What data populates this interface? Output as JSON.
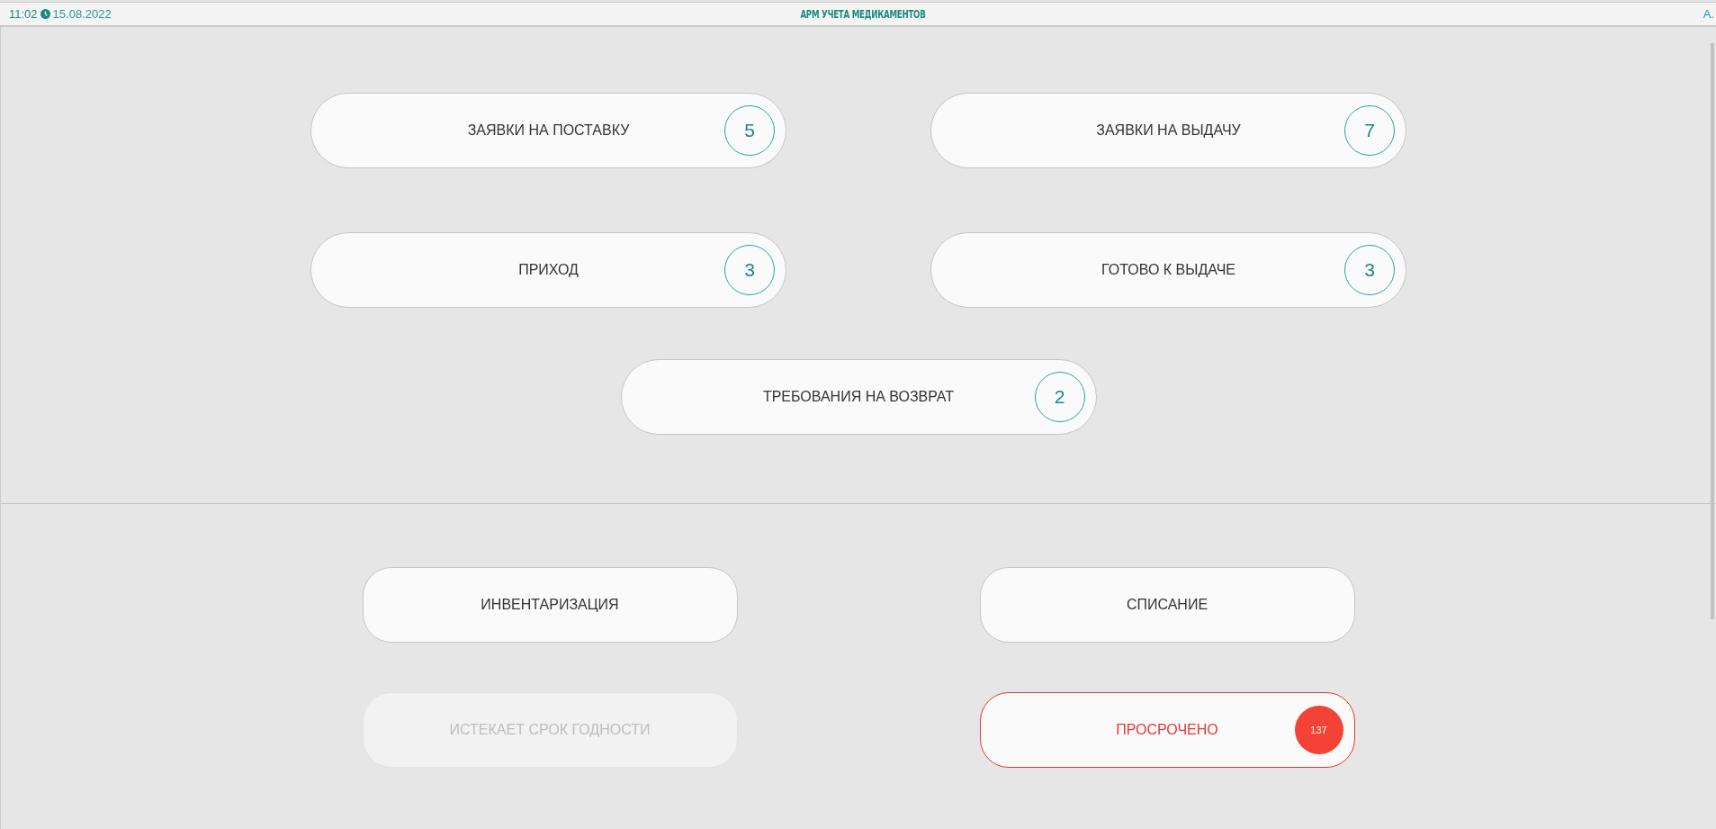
{
  "header": {
    "time": "11:02",
    "date": "15.08.2022",
    "title": "АРМ УЧЕТА МЕДИКАМЕНТОВ",
    "user": "А."
  },
  "top_buttons": [
    {
      "label": "ЗАЯВКИ НА ПОСТАВКУ",
      "count": "5"
    },
    {
      "label": "ЗАЯВКИ НА ВЫДАЧУ",
      "count": "7"
    },
    {
      "label": "ПРИХОД",
      "count": "3"
    },
    {
      "label": "ГОТОВО К ВЫДАЧЕ",
      "count": "3"
    },
    {
      "label": "ТРЕБОВАНИЯ НА ВОЗВРАТ",
      "count": "2"
    }
  ],
  "bottom_buttons": [
    {
      "label": "ИНВЕНТАРИЗАЦИЯ",
      "kind": "normal",
      "disabled": false
    },
    {
      "label": "СПИСАНИЕ",
      "kind": "normal",
      "disabled": false
    },
    {
      "label": "ИСТЕКАЕТ СРОК ГОДНОСТИ",
      "kind": "normal",
      "disabled": true
    },
    {
      "label": "ПРОСРОЧЕНО",
      "kind": "alert",
      "disabled": false,
      "count": "137"
    }
  ]
}
